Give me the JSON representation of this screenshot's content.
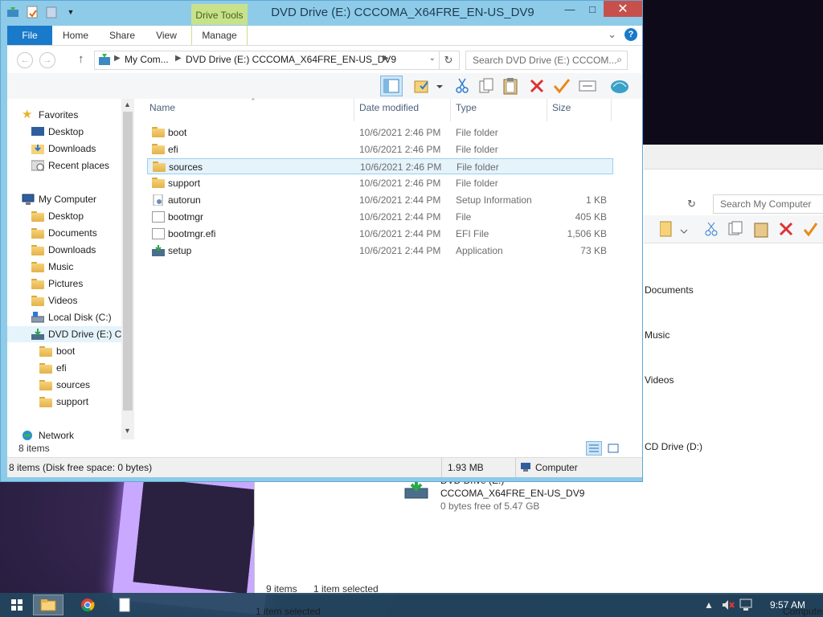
{
  "window": {
    "title": "DVD Drive (E:) CCCOMA_X64FRE_EN-US_DV9",
    "context_tab": "Drive Tools",
    "close_glyph": "✕",
    "minimize_glyph": "—",
    "maximize_glyph": "□"
  },
  "ribbon": {
    "tabs": [
      "File",
      "Home",
      "Share",
      "View",
      "Manage"
    ],
    "help": "?",
    "expand": "⌄"
  },
  "address": {
    "crumbs": [
      "My Com...",
      "DVD Drive (E:) CCCOMA_X64FRE_EN-US_DV9"
    ],
    "search_placeholder": "Search DVD Drive (E:) CCCOM...",
    "back": "←",
    "forward": "→",
    "up": "↑",
    "refresh": "↻",
    "dropdown": "⌄",
    "search_glyph": "⌕"
  },
  "toolbar": {
    "icons": [
      "layout-pane-icon",
      "properties-folder-icon",
      "cut-icon",
      "copy-icon",
      "paste-icon",
      "delete-icon",
      "rename-check-icon",
      "select-icon",
      "shell-icon"
    ]
  },
  "nav_pane": {
    "favorites": {
      "label": "Favorites",
      "items": [
        "Desktop",
        "Downloads",
        "Recent places"
      ]
    },
    "computer": {
      "label": "My Computer",
      "items": [
        "Desktop",
        "Documents",
        "Downloads",
        "Music",
        "Pictures",
        "Videos",
        "Local Disk (C:)",
        "DVD Drive (E:) CC"
      ]
    },
    "dvd_children": [
      "boot",
      "efi",
      "sources",
      "support"
    ],
    "network": "Network",
    "items_count": "8 items"
  },
  "columns": {
    "name": "Name",
    "date": "Date modified",
    "type": "Type",
    "size": "Size"
  },
  "files": [
    {
      "name": "boot",
      "date": "10/6/2021 2:46 PM",
      "type": "File folder",
      "size": "",
      "kind": "folder"
    },
    {
      "name": "efi",
      "date": "10/6/2021 2:46 PM",
      "type": "File folder",
      "size": "",
      "kind": "folder"
    },
    {
      "name": "sources",
      "date": "10/6/2021 2:46 PM",
      "type": "File folder",
      "size": "",
      "kind": "folder"
    },
    {
      "name": "support",
      "date": "10/6/2021 2:46 PM",
      "type": "File folder",
      "size": "",
      "kind": "folder"
    },
    {
      "name": "autorun",
      "date": "10/6/2021 2:44 PM",
      "type": "Setup Information",
      "size": "1 KB",
      "kind": "inf"
    },
    {
      "name": "bootmgr",
      "date": "10/6/2021 2:44 PM",
      "type": "File",
      "size": "405 KB",
      "kind": "file"
    },
    {
      "name": "bootmgr.efi",
      "date": "10/6/2021 2:44 PM",
      "type": "EFI File",
      "size": "1,506 KB",
      "kind": "file"
    },
    {
      "name": "setup",
      "date": "10/6/2021 2:44 PM",
      "type": "Application",
      "size": "73 KB",
      "kind": "app"
    }
  ],
  "status": {
    "summary": "8 items (Disk free space: 0 bytes)",
    "size": "1.93 MB",
    "location": "Computer"
  },
  "back_window": {
    "search_placeholder": "Search My Computer",
    "refresh": "↻",
    "items": [
      "Documents",
      "Music",
      "Videos",
      "CD Drive (D:)"
    ],
    "dvd_label": "DVD Drive (E:)",
    "dvd_name": "CCCOMA_X64FRE_EN-US_DV9",
    "dvd_free": "0 bytes free of 5.47 GB",
    "status_items": "9 items",
    "status_selected": "1 item selected",
    "status_bottom": "1 item selected",
    "status_location": "Computer"
  },
  "taskbar": {
    "clock": "9:57 AM",
    "tray_up": "▲",
    "apps": [
      "start-icon",
      "explorer-icon",
      "chrome-icon",
      "file-icon"
    ]
  },
  "colors": {
    "accent": "#1979ca",
    "selection": "#e5f3fb",
    "context_tab": "#c8e28b",
    "close_btn": "#c7504c"
  }
}
